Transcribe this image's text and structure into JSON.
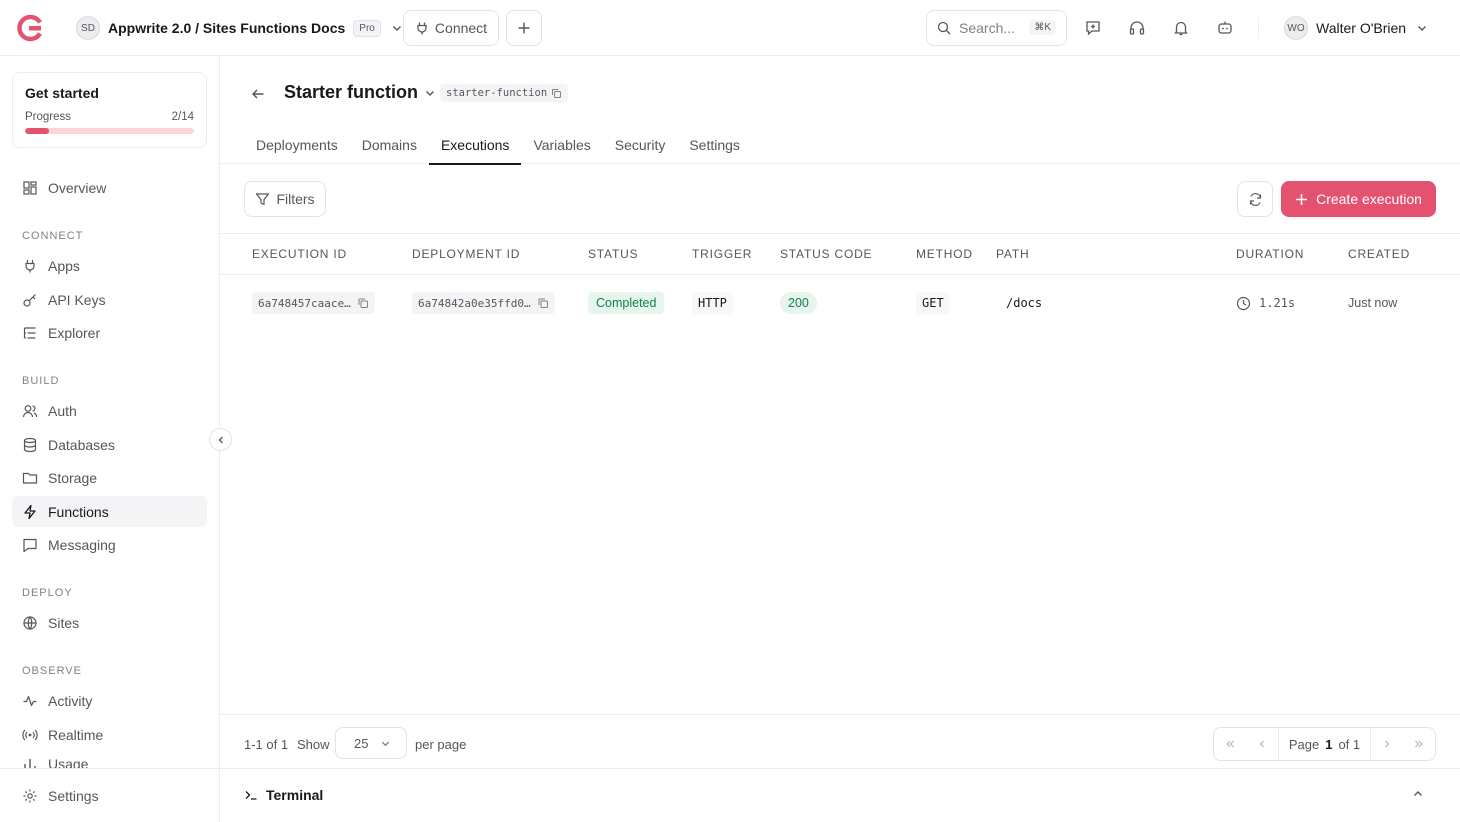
{
  "topbar": {
    "project_initials": "SD",
    "project_name": "Appwrite 2.0 / Sites Functions Docs",
    "plan_badge": "Pro",
    "connect_label": "Connect",
    "search_placeholder": "Search...",
    "search_shortcut": "⌘K",
    "user_initials": "WO",
    "user_name": "Walter O'Brien"
  },
  "sidebar": {
    "get_started": {
      "title": "Get started",
      "progress_label": "Progress",
      "progress_text": "2/14",
      "progress_fraction": 0.143
    },
    "overview": "Overview",
    "sections": {
      "connect": "CONNECT",
      "build": "BUILD",
      "deploy": "DEPLOY",
      "observe": "OBSERVE"
    },
    "connect_items": [
      "Apps",
      "API Keys",
      "Explorer"
    ],
    "build_items": [
      "Auth",
      "Databases",
      "Storage",
      "Functions",
      "Messaging"
    ],
    "deploy_items": [
      "Sites"
    ],
    "observe_items": [
      "Activity",
      "Realtime",
      "Usage"
    ],
    "settings": "Settings"
  },
  "function": {
    "title": "Starter function",
    "id": "starter-function",
    "tabs": [
      "Deployments",
      "Domains",
      "Executions",
      "Variables",
      "Security",
      "Settings"
    ],
    "active_tab": "Executions"
  },
  "toolbar": {
    "filters_label": "Filters",
    "create_label": "Create execution"
  },
  "table": {
    "columns": [
      "EXECUTION ID",
      "DEPLOYMENT ID",
      "STATUS",
      "TRIGGER",
      "STATUS CODE",
      "METHOD",
      "PATH",
      "DURATION",
      "CREATED"
    ],
    "rows": [
      {
        "execution_id": "6a748457caace…",
        "deployment_id": "6a74842a0e35ffd0…",
        "status": "Completed",
        "trigger": "HTTP",
        "status_code": "200",
        "method": "GET",
        "path": "/docs",
        "duration": "1.21s",
        "created": "Just now"
      }
    ]
  },
  "pagination": {
    "range": "1-1 of 1",
    "show_label": "Show",
    "per_page_value": "25",
    "per_page_label": "per page",
    "page_label": "Page",
    "current_page": "1",
    "of_label": "of 1"
  },
  "terminal": {
    "label": "Terminal"
  },
  "colors": {
    "accent": "#e5526f",
    "success": "#10804e"
  }
}
